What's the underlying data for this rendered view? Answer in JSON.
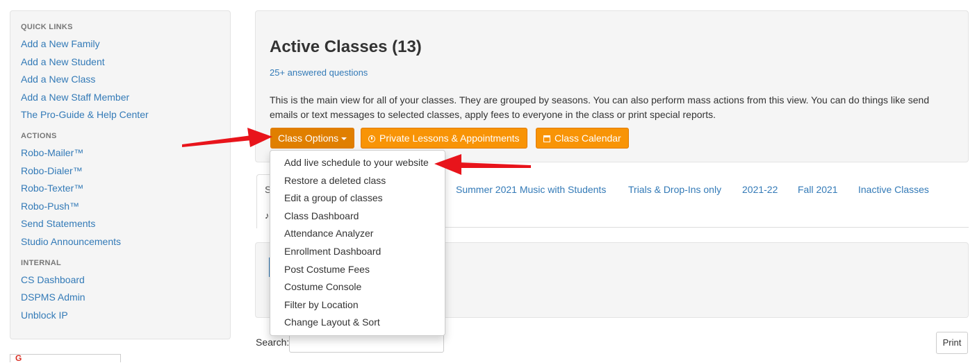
{
  "sidebar": {
    "quick_links_heading": "QUICK LINKS",
    "quick_links": [
      "Add a New Family",
      "Add a New Student",
      "Add a New Class",
      "Add a New Staff Member",
      "The Pro-Guide & Help Center"
    ],
    "actions_heading": "ACTIONS",
    "actions": [
      "Robo-Mailer™",
      "Robo-Dialer™",
      "Robo-Texter™",
      "Robo-Push™",
      "Send Statements",
      "Studio Announcements"
    ],
    "internal_heading": "INTERNAL",
    "internal": [
      "CS Dashboard",
      "DSPMS Admin",
      "Unblock IP"
    ]
  },
  "main": {
    "title": "Active Classes (13)",
    "answered_link": "25+ answered questions",
    "description": "This is the main view for all of your classes. They are grouped by seasons. You can also perform mass actions from this view. You can do things like send emails or text messages to selected classes, apply fees to everyone in the class or print special reports.",
    "buttons": {
      "class_options": "Class Options",
      "private_lessons": "Private Lessons & Appointments",
      "class_calendar": "Class Calendar"
    },
    "tabs": {
      "first_partial": "S",
      "items": [
        "Summer 2021 Music with Students",
        "Trials & Drop-Ins only",
        "2021-22",
        "Fall 2021",
        "Inactive Classes"
      ]
    },
    "search_label": "Search:",
    "search_value": "",
    "print_label": "Print"
  },
  "dropdown": {
    "items": [
      "Add live schedule to your website",
      "Restore a deleted class",
      "Edit a group of classes",
      "Class Dashboard",
      "Attendance Analyzer",
      "Enrollment Dashboard",
      "Post Costume Fees",
      "Costume Console",
      "Filter by Location",
      "Change Layout & Sort"
    ]
  },
  "colors": {
    "accent_orange": "#f89406",
    "link_blue": "#337ab7",
    "annotation_red": "#e8141b"
  },
  "icons": {
    "private_lessons": "clock-icon",
    "class_calendar": "calendar-icon",
    "class_options": "caret-down-icon"
  }
}
